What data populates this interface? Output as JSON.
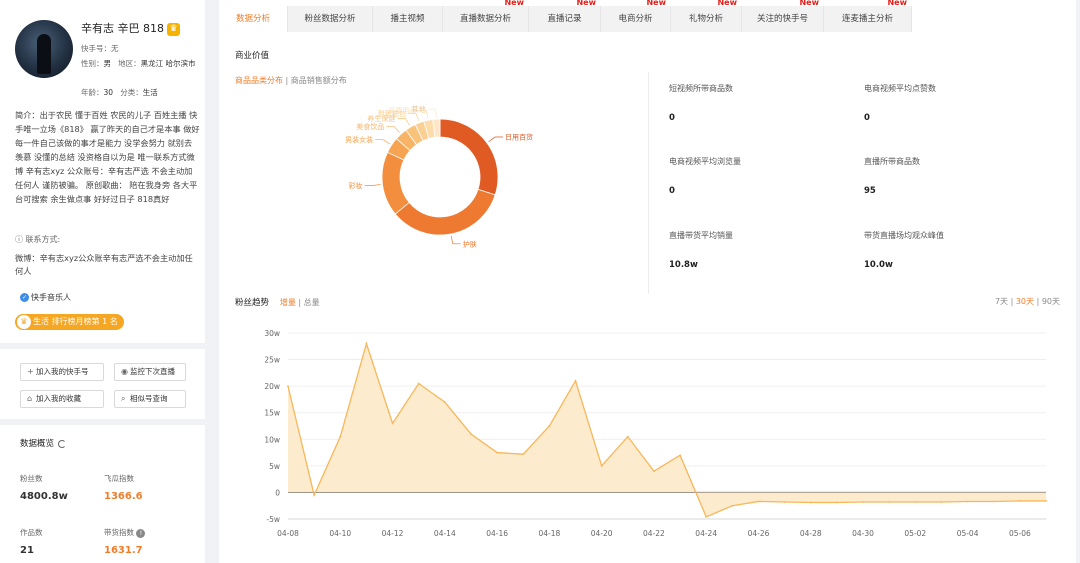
{
  "profile": {
    "name": "辛有志 辛巴 818",
    "kuaishou_id": "快手号：无",
    "gender_label": "性别：",
    "gender": "男",
    "region_label": "地区：",
    "region": "黑龙江 哈尔滨市",
    "age_label": "年龄：",
    "age": "30",
    "category_label": "分类：",
    "category": "生活",
    "bio": "简介：出于农民 懂于百姓 农民的儿子 百姓主播 快手唯一立场《818》 赢了昨天的自己才是本事 做好每一件自己该做的事才是能力 没学会努力 就别去羡慕 没懂的总结 没资格自以为是 唯一联系方式微博 辛有志xyz 公众账号：辛有志严选 不会主动加任何人 谨防被骗。 原创歌曲： 陪在我身旁 各大平台可搜索 余生做点事 好好过日子 818真好",
    "contact_header": "联系方式:",
    "contact": "微博：辛有志xyz公众账辛有志严选不会主动加任何人",
    "tag": "快手音乐人",
    "rank": "生活 排行榜月榜第 1 名"
  },
  "actions": {
    "add_kuaishou": "加入我的快手号",
    "monitor_live": "监控下次直播",
    "add_favorite": "加入我的收藏",
    "similar_search": "相似号查询"
  },
  "overview": {
    "title": "数据概览",
    "fans_label": "粉丝数",
    "fans": "4800.8w",
    "feigua_label": "飞瓜指数",
    "feigua": "1366.6",
    "works_label": "作品数",
    "works": "21",
    "sales_label": "带货指数",
    "sales": "1631.7"
  },
  "tabs": [
    {
      "label": "数据分析",
      "new": ""
    },
    {
      "label": "粉丝数据分析",
      "new": ""
    },
    {
      "label": "播主视频",
      "new": ""
    },
    {
      "label": "直播数据分析",
      "new": "New"
    },
    {
      "label": "直播记录",
      "new": "New"
    },
    {
      "label": "电商分析",
      "new": "New"
    },
    {
      "label": "礼物分析",
      "new": "New"
    },
    {
      "label": "关注的快手号",
      "new": "New"
    },
    {
      "label": "连麦播主分析",
      "new": "New"
    }
  ],
  "commerce": {
    "title": "商业价值",
    "subtab_active": "商品品类分布",
    "subtab_other": "商品销售额分布",
    "stats": [
      {
        "label": "短视频所带商品数",
        "value": "0"
      },
      {
        "label": "电商视频平均点赞数",
        "value": "0"
      },
      {
        "label": "电商视频平均浏览量",
        "value": "0"
      },
      {
        "label": "直播所带商品数",
        "value": "95"
      },
      {
        "label": "直播带货平均销量",
        "value": "10.8w"
      },
      {
        "label": "带货直播场均观众峰值",
        "value": "10.0w"
      }
    ]
  },
  "fans_trend": {
    "title": "粉丝趋势",
    "sub_active": "增量",
    "sub_other": "总量",
    "range_7": "7天",
    "range_30": "30天",
    "range_90": "90天"
  },
  "colors": {
    "accent": "#f07d2a",
    "new_badge": "#e0201b",
    "area_fill": "#fde7c4",
    "area_line": "#f7b75a"
  },
  "chart_data": [
    {
      "type": "pie",
      "title": "",
      "categories": [
        "日用百货",
        "护肤",
        "彩妆",
        "男装女装",
        "美食饮品",
        "养生保健",
        "鞋靴箱包",
        "母婴用品",
        "其他"
      ],
      "values": [
        30,
        34,
        18,
        4.5,
        3.5,
        3,
        2.5,
        2.5,
        2
      ]
    },
    {
      "type": "area",
      "title": "",
      "xlabel": "",
      "ylabel": "",
      "x": [
        "04-08",
        "04-09",
        "04-10",
        "04-11",
        "04-12",
        "04-13",
        "04-14",
        "04-15",
        "04-16",
        "04-17",
        "04-18",
        "04-19",
        "04-20",
        "04-21",
        "04-22",
        "04-23",
        "04-24",
        "04-25",
        "04-26",
        "04-27",
        "04-28",
        "04-29",
        "04-30",
        "05-01",
        "05-02",
        "05-03",
        "05-04",
        "05-05",
        "05-06",
        "05-07"
      ],
      "x_ticks": [
        "04-08",
        "04-10",
        "04-12",
        "04-14",
        "04-16",
        "04-18",
        "04-20",
        "04-22",
        "04-24",
        "04-26",
        "04-28",
        "04-30",
        "05-02",
        "05-04",
        "05-06"
      ],
      "y_ticks": [
        "-5w",
        "0",
        "5w",
        "10w",
        "15w",
        "20w",
        "25w",
        "30w"
      ],
      "values": [
        20,
        -0.5,
        10.5,
        28,
        13,
        20.5,
        17,
        11,
        7.5,
        7.2,
        12.5,
        21,
        5,
        10.5,
        4,
        7,
        -4.6,
        -2.5,
        -1.7,
        -1.8,
        -1.9,
        -1.9,
        -1.8,
        -1.8,
        -1.8,
        -1.8,
        -1.7,
        -1.7,
        -1.6,
        -1.6
      ],
      "ylim": [
        -5,
        30
      ],
      "grid": true
    }
  ]
}
